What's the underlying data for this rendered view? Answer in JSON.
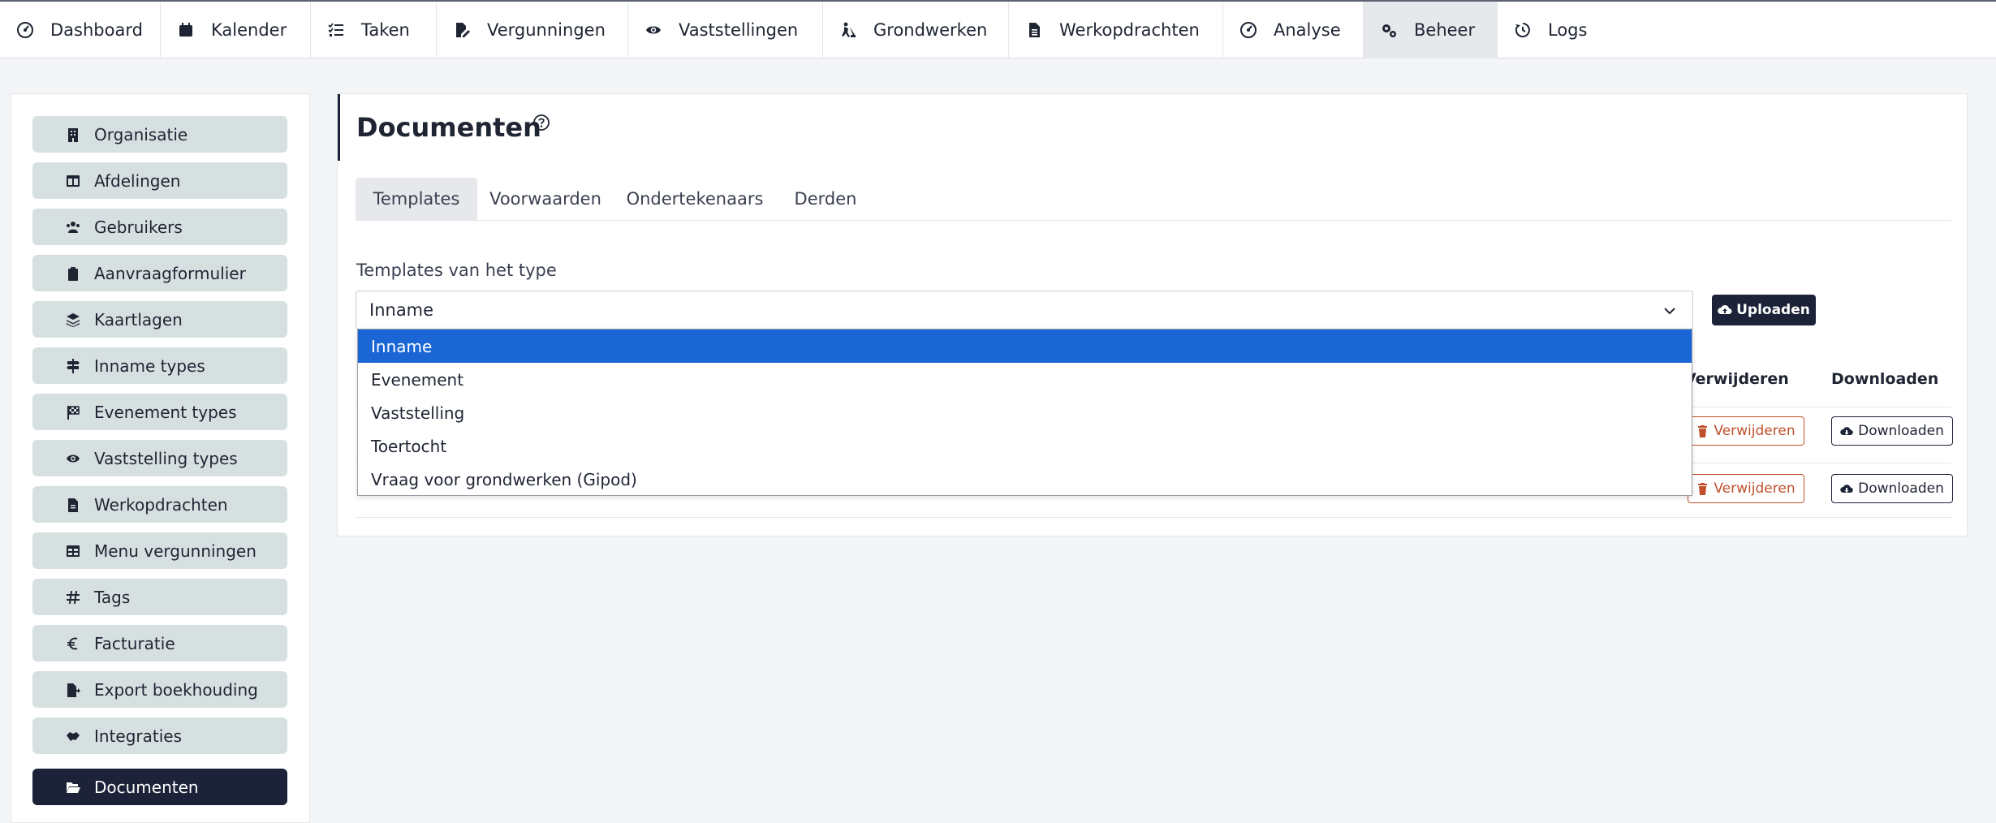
{
  "topnav": {
    "items": [
      {
        "label": "Dashboard",
        "icon": "gauge-icon"
      },
      {
        "label": "Kalender",
        "icon": "calendar-icon"
      },
      {
        "label": "Taken",
        "icon": "checklist-icon"
      },
      {
        "label": "Vergunningen",
        "icon": "file-signature-icon"
      },
      {
        "label": "Vaststellingen",
        "icon": "eye-icon"
      },
      {
        "label": "Grondwerken",
        "icon": "digging-person-icon"
      },
      {
        "label": "Werkopdrachten",
        "icon": "file-icon"
      },
      {
        "label": "Analyse",
        "icon": "gauge-icon"
      },
      {
        "label": "Beheer",
        "icon": "gears-icon",
        "active": true
      },
      {
        "label": "Logs",
        "icon": "history-icon"
      }
    ]
  },
  "sidebar": {
    "items": [
      {
        "label": "Organisatie",
        "icon": "building-icon"
      },
      {
        "label": "Afdelingen",
        "icon": "table-columns-icon"
      },
      {
        "label": "Gebruikers",
        "icon": "users-icon"
      },
      {
        "label": "Aanvraagformulier",
        "icon": "clipboard-icon"
      },
      {
        "label": "Kaartlagen",
        "icon": "layers-icon"
      },
      {
        "label": "Inname types",
        "icon": "signs-post-icon"
      },
      {
        "label": "Evenement types",
        "icon": "flag-checkered-icon"
      },
      {
        "label": "Vaststelling types",
        "icon": "eye-icon"
      },
      {
        "label": "Werkopdrachten",
        "icon": "file-icon"
      },
      {
        "label": "Menu vergunningen",
        "icon": "table-icon"
      },
      {
        "label": "Tags",
        "icon": "hashtag-icon"
      },
      {
        "label": "Facturatie",
        "icon": "euro-icon"
      },
      {
        "label": "Export boekhouding",
        "icon": "file-export-icon"
      },
      {
        "label": "Integraties",
        "icon": "handshake-icon"
      },
      {
        "label": "Documenten",
        "icon": "folder-open-icon",
        "active": true
      }
    ]
  },
  "main": {
    "title": "Documenten",
    "tabs": [
      {
        "label": "Templates",
        "active": true
      },
      {
        "label": "Voorwaarden"
      },
      {
        "label": "Ondertekenaars"
      },
      {
        "label": "Derden"
      }
    ],
    "field_label": "Templates van het type",
    "select_value": "Inname",
    "upload_label": "Uploaden",
    "table": {
      "headers": [
        "Verwijderen",
        "Downloaden"
      ],
      "rows": [
        {
          "delete_label": "Verwijderen",
          "download_label": "Downloaden"
        },
        {
          "delete_label": "Verwijderen",
          "download_label": "Downloaden"
        }
      ]
    },
    "dropdown_options": [
      {
        "label": "Inname",
        "selected": true
      },
      {
        "label": "Evenement"
      },
      {
        "label": "Vaststelling"
      },
      {
        "label": "Toertocht"
      },
      {
        "label": "Vraag voor grondwerken (Gipod)"
      }
    ]
  },
  "colors": {
    "accent_dark": "#1c2238",
    "sidebar_item_bg": "#d6e0e0",
    "danger": "#c0502a",
    "selected_option": "#1a66d4"
  }
}
